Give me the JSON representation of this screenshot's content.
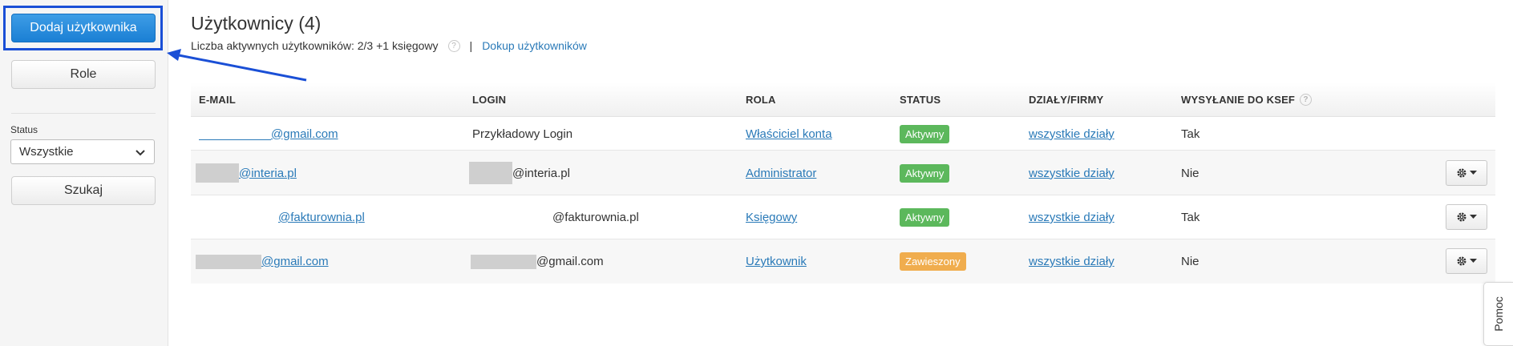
{
  "sidebar": {
    "add_user_label": "Dodaj użytkownika",
    "roles_label": "Role",
    "status_label": "Status",
    "status_value": "Wszystkie",
    "search_label": "Szukaj"
  },
  "header": {
    "title": "Użytkownicy (4)",
    "active_users_text": "Liczba aktywnych użytkowników: 2/3 +1 księgowy",
    "separator": "|",
    "buy_users_link": "Dokup użytkowników"
  },
  "table": {
    "columns": [
      "E-MAIL",
      "LOGIN",
      "ROLA",
      "STATUS",
      "DZIAŁY/FIRMY",
      "WYSYŁANIE DO KSEF"
    ],
    "rows": [
      {
        "email": "@gmail.com",
        "login": "Przykładowy Login",
        "role": "Właściciel konta",
        "status": "Aktywny",
        "departments": "wszystkie działy",
        "ksef": "Tak"
      },
      {
        "email": "@interia.pl",
        "login": "@interia.pl",
        "role": "Administrator",
        "status": "Aktywny",
        "departments": "wszystkie działy",
        "ksef": "Nie"
      },
      {
        "email": "@fakturownia.pl",
        "login": "@fakturownia.pl",
        "role": "Księgowy",
        "status": "Aktywny",
        "departments": "wszystkie działy",
        "ksef": "Tak"
      },
      {
        "email": "@gmail.com",
        "login": "@gmail.com",
        "role": "Użytkownik",
        "status": "Zawieszony",
        "departments": "wszystkie działy",
        "ksef": "Nie"
      }
    ]
  },
  "help_tab": {
    "label": "Pomoc"
  },
  "colors": {
    "primary": "#1a7fd4",
    "highlight": "#1a4fd6",
    "status_active": "#5cb85c",
    "status_suspended": "#f0ad4e",
    "link": "#2a7ab8"
  },
  "icons": {
    "help": "question-circle-icon",
    "gear": "gear-icon",
    "caret": "caret-down-icon",
    "select": "chevron-down-icon"
  }
}
